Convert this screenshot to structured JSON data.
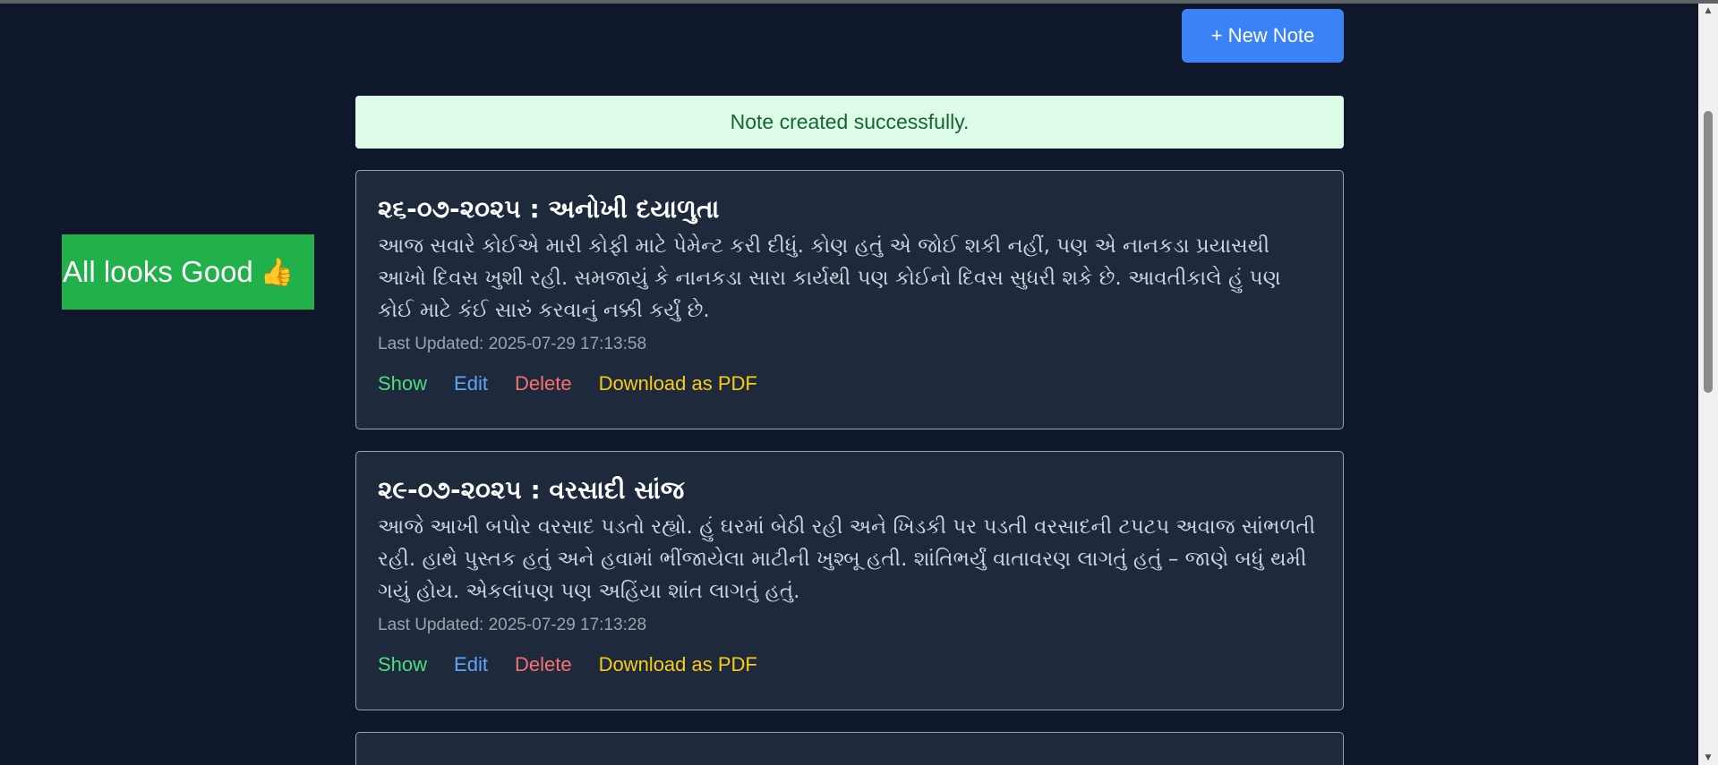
{
  "toolbar": {
    "new_note_label": "+ New Note"
  },
  "flash": {
    "message": "Note created successfully."
  },
  "badge": {
    "text": "All looks Good",
    "emoji": "👍"
  },
  "notes": [
    {
      "title": "૨૬-૦૭-૨૦૨૫ : અનોખી દયાળુતા",
      "body": "આજ સવારે કોઈએ મારી કોફી માટે પેમેન્ટ કરી દીધું. કોણ હતું એ જોઈ શકી નહીં, પણ એ નાનકડા પ્રયાસથી આખો દિવસ ખુશી રહી. સમજાયું કે નાનકડા સારા કાર્યથી પણ કોઈનો દિવસ સુધરી શકે છે. આવતીકાલે હું પણ કોઈ માટે કંઈ સારું કરવાનું નક્કી કર્યું છે.",
      "updated": "Last Updated: 2025-07-29 17:13:58",
      "actions": {
        "show": "Show",
        "edit": "Edit",
        "delete": "Delete",
        "pdf": "Download as PDF"
      }
    },
    {
      "title": "૨૯-૦૭-૨૦૨૫ : વરસાદી સાંજ",
      "body": "આજે આખી બપોર વરસાદ પડતો રહ્યો. હું ઘરમાં બેઠી રહી અને ખિડકી પર પડતી વરસાદની ટપટપ અવાજ સાંભળતી રહી. હાથે પુસ્તક હતું અને હવામાં ભીંજાયેલા માટીની ખુશ્બૂ હતી. શાંતિભર્યું વાતાવરણ લાગતું હતું – જાણે બધું થમી ગયું હોય. એકલાંપણ પણ અહિંયા શાંત લાગતું હતું.",
      "updated": "Last Updated: 2025-07-29 17:13:28",
      "actions": {
        "show": "Show",
        "edit": "Edit",
        "delete": "Delete",
        "pdf": "Download as PDF"
      }
    }
  ],
  "colors": {
    "background": "#0f172a",
    "card": "#1e293b",
    "primary": "#3b82f6",
    "success_bg": "#dcfce7",
    "success_text": "#166534",
    "show": "#4ade80",
    "edit": "#60a5fa",
    "delete": "#f87171",
    "pdf": "#facc15",
    "badge": "#22b04b"
  }
}
